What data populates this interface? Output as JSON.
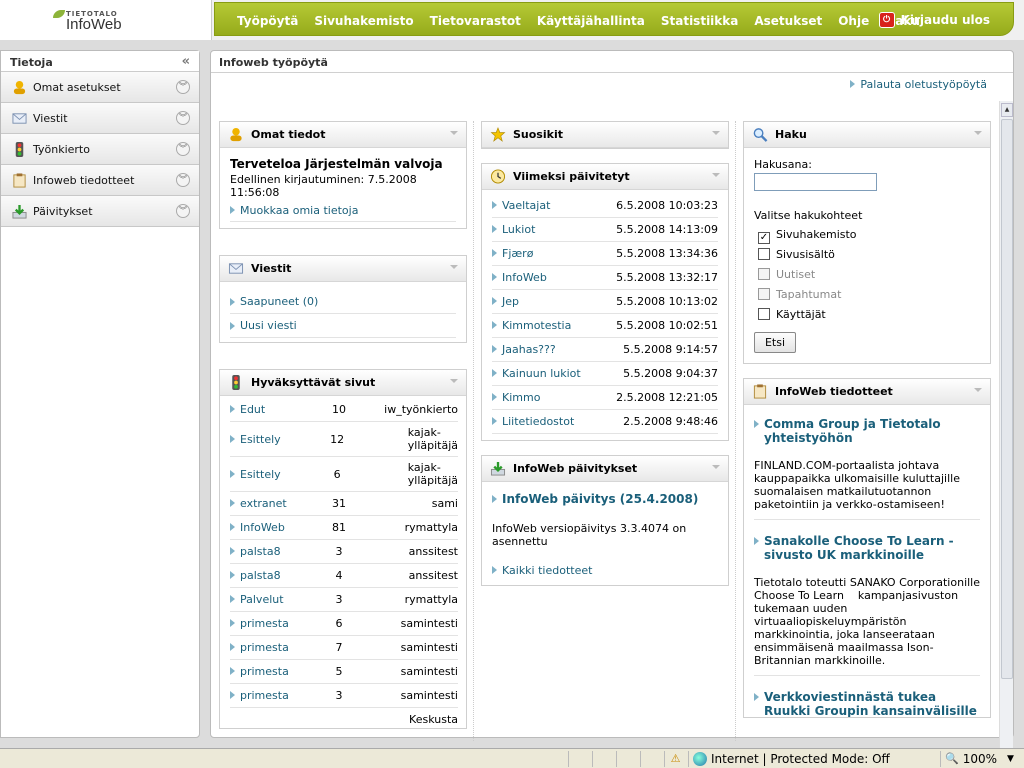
{
  "logo": {
    "small": "TIETOTALO",
    "big": "InfoWeb"
  },
  "topnav": {
    "items": [
      "Työpöytä",
      "Sivuhakemisto",
      "Tietovarastot",
      "Käyttäjähallinta",
      "Statistiikka",
      "Asetukset",
      "Ohje",
      "Haku"
    ],
    "logout": "Kirjaudu ulos"
  },
  "sidebar": {
    "title": "Tietoja",
    "items": [
      {
        "label": "Omat asetukset",
        "icon": "user-settings-icon"
      },
      {
        "label": "Viestit",
        "icon": "envelope-icon"
      },
      {
        "label": "Työnkierto",
        "icon": "traffic-light-icon"
      },
      {
        "label": "Infoweb tiedotteet",
        "icon": "clipboard-icon"
      },
      {
        "label": "Päivitykset",
        "icon": "download-icon"
      }
    ]
  },
  "main": {
    "title": "Infoweb työpöytä",
    "reset_link": "Palauta oletustyöpöytä"
  },
  "omat": {
    "title": "Omat tiedot",
    "welcome": "Terveteloa Järjestelmän valvoja",
    "lastlogin": "Edellinen kirjautuminen: 7.5.2008 11:56:08",
    "edit": "Muokkaa omia tietoja"
  },
  "viestit": {
    "title": "Viestit",
    "links": [
      "Saapuneet (0)",
      "Uusi viesti"
    ]
  },
  "hyv": {
    "title": "Hyväksyttävät sivut",
    "rows": [
      {
        "name": "Edut",
        "count": "10",
        "owner": "iw_työnkierto"
      },
      {
        "name": "Esittely",
        "count": "12",
        "owner": "kajak-ylläpitäjä"
      },
      {
        "name": "Esittely",
        "count": "6",
        "owner": "kajak-ylläpitäjä"
      },
      {
        "name": "extranet",
        "count": "31",
        "owner": "sami"
      },
      {
        "name": "InfoWeb",
        "count": "81",
        "owner": "rymattyla"
      },
      {
        "name": "palsta8",
        "count": "3",
        "owner": "anssitest"
      },
      {
        "name": "palsta8",
        "count": "4",
        "owner": "anssitest"
      },
      {
        "name": "Palvelut",
        "count": "3",
        "owner": "rymattyla"
      },
      {
        "name": "primesta",
        "count": "6",
        "owner": "samintesti"
      },
      {
        "name": "primesta",
        "count": "7",
        "owner": "samintesti"
      },
      {
        "name": "primesta",
        "count": "5",
        "owner": "samintesti"
      },
      {
        "name": "primesta",
        "count": "3",
        "owner": "samintesti"
      },
      {
        "name": "",
        "count": "",
        "owner": "Keskusta"
      }
    ]
  },
  "suosikit": {
    "title": "Suosikit"
  },
  "viimeksi": {
    "title": "Viimeksi päivitetyt",
    "rows": [
      {
        "name": "Vaeltajat",
        "date": "6.5.2008 10:03:23"
      },
      {
        "name": "Lukiot",
        "date": "5.5.2008 14:13:09"
      },
      {
        "name": "Fjærø",
        "date": "5.5.2008 13:34:36"
      },
      {
        "name": "InfoWeb",
        "date": "5.5.2008 13:32:17"
      },
      {
        "name": "Jep",
        "date": "5.5.2008 10:13:02"
      },
      {
        "name": "Kimmotestia",
        "date": "5.5.2008 10:02:51"
      },
      {
        "name": "Jaahas???",
        "date": "5.5.2008 9:14:57"
      },
      {
        "name": "Kainuun lukiot",
        "date": "5.5.2008 9:04:37"
      },
      {
        "name": "Kimmo",
        "date": "2.5.2008 12:21:05"
      },
      {
        "name": "Liitetiedostot",
        "date": "2.5.2008 9:48:46"
      }
    ]
  },
  "paivitykset": {
    "title": "InfoWeb päivitykset",
    "headline": "InfoWeb päivitys (25.4.2008)",
    "text": "InfoWeb versiopäivitys 3.3.4074 on asennettu",
    "all": "Kaikki tiedotteet"
  },
  "haku": {
    "title": "Haku",
    "label": "Hakusana:",
    "value": "",
    "targets_label": "Valitse hakukohteet",
    "options": [
      {
        "label": "Sivuhakemisto",
        "checked": true,
        "disabled": false
      },
      {
        "label": "Sivusisältö",
        "checked": false,
        "disabled": false
      },
      {
        "label": "Uutiset",
        "checked": false,
        "disabled": true
      },
      {
        "label": "Tapahtumat",
        "checked": false,
        "disabled": true
      },
      {
        "label": "Käyttäjät",
        "checked": false,
        "disabled": false
      }
    ],
    "button": "Etsi"
  },
  "tiedotteet": {
    "title": "InfoWeb tiedotteet",
    "items": [
      {
        "headline": "Comma Group ja Tietotalo yhteistyöhön",
        "text": "FINLAND.COM-portaalista johtava kauppapaikka ulkomaisille kuluttajille suomalaisen matkailutuotannon paketointiin ja verkko-ostamiseen!"
      },
      {
        "headline": "Sanakolle Choose To Learn -sivusto UK markkinoille",
        "text": "Tietotalo toteutti SANAKO Corporationille Choose To Learn    kampanjasivuston tukemaan uuden virtuaaliopiskeluympäristön markkinointia, joka lanseerataan ensimmäisenä maailmassa Ison-Britannian markkinoille."
      },
      {
        "headline": "Verkkoviestinnästä tukea Ruukki Groupin kansainvälisille tavoitteille",
        "text": ""
      }
    ]
  },
  "statusbar": {
    "zone": "Internet | Protected Mode: Off",
    "zoom": "100%"
  },
  "colors": {
    "nav_green": "#a3b825",
    "link": "#1a5f7a",
    "heading_link": "#1a5f7a"
  }
}
